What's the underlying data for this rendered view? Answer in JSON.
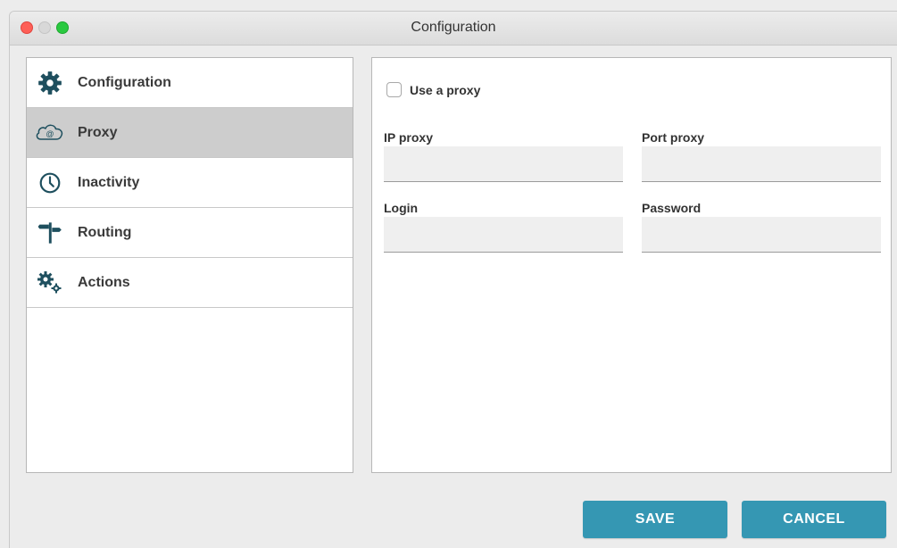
{
  "window": {
    "title": "Configuration"
  },
  "sidebar": {
    "items": [
      {
        "label": "Configuration",
        "icon": "gear-icon"
      },
      {
        "label": "Proxy",
        "icon": "cloud-at-icon",
        "active": true
      },
      {
        "label": "Inactivity",
        "icon": "clock-icon"
      },
      {
        "label": "Routing",
        "icon": "signpost-icon"
      },
      {
        "label": "Actions",
        "icon": "gears-icon"
      }
    ]
  },
  "proxy": {
    "use_proxy_label": "Use a proxy",
    "use_proxy_checked": false,
    "ip_label": "IP proxy",
    "ip_value": "",
    "port_label": "Port proxy",
    "port_value": "",
    "login_label": "Login",
    "login_value": "",
    "password_label": "Password",
    "password_value": ""
  },
  "buttons": {
    "save": "SAVE",
    "cancel": "CANCEL"
  },
  "colors": {
    "accent": "#3597b3",
    "icon": "#1e4f5e",
    "active_item": "#cdcdcd"
  }
}
